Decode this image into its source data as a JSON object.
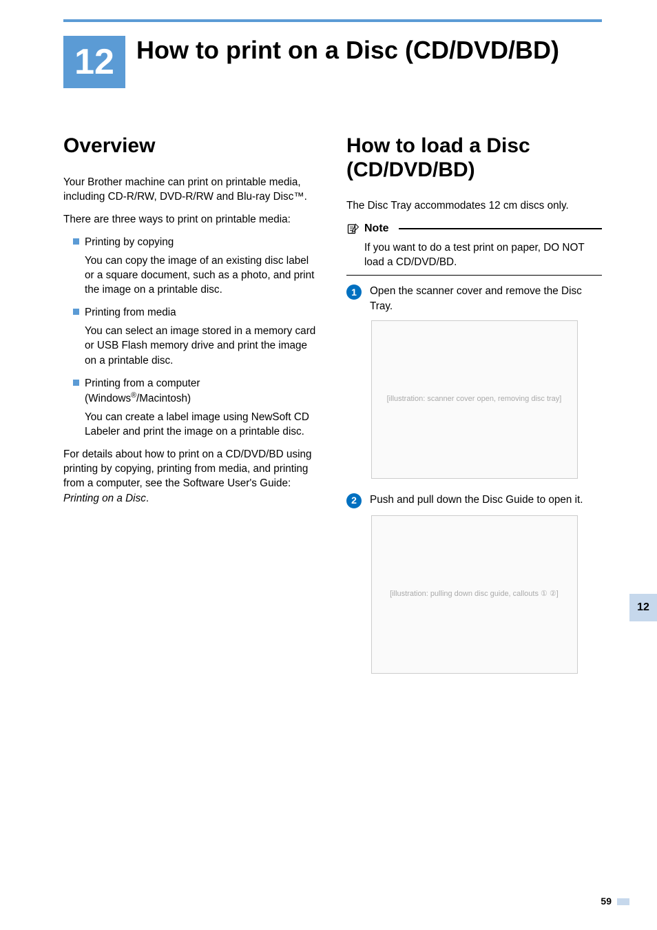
{
  "chapter": {
    "number": "12",
    "title": "How to print on a Disc (CD/DVD/BD)"
  },
  "left": {
    "heading": "Overview",
    "intro1": "Your Brother machine can print on printable media, including CD-R/RW, DVD-R/RW and Blu-ray Disc™.",
    "intro2": "There are three ways to print on printable media:",
    "bullets": [
      {
        "title": "Printing by copying",
        "desc": "You can copy the image of an existing disc label or a square document, such as a photo, and print the image on a printable disc."
      },
      {
        "title": "Printing from media",
        "desc": "You can select an image stored in a memory card or USB Flash memory drive and print the image on a printable disc."
      },
      {
        "title": "Printing from a computer (Windows®/Macintosh)",
        "title_line1": "Printing from a computer",
        "title_line2_pre": "(Windows",
        "title_line2_post": "/Macintosh)",
        "desc": "You can create a label image using NewSoft CD Labeler and print the image on a printable disc."
      }
    ],
    "footer_pre": "For details about how to print on a CD/DVD/BD using printing by copying, printing from media, and printing from a computer, see the Software User's Guide: ",
    "footer_em": "Printing on a Disc",
    "footer_post": "."
  },
  "right": {
    "heading": "How to load a Disc (CD/DVD/BD)",
    "intro": "The Disc Tray accommodates 12 cm discs only.",
    "note_label": "Note",
    "note_body": "If you want to do a test print on paper, DO NOT load a CD/DVD/BD.",
    "steps": [
      {
        "num": "1",
        "text": "Open the scanner cover and remove the Disc Tray."
      },
      {
        "num": "2",
        "text": "Push and pull down the Disc Guide to open it."
      }
    ],
    "fig1_alt": "[illustration: scanner cover open, removing disc tray]",
    "fig2_alt": "[illustration: pulling down disc guide, callouts ① ②]"
  },
  "side_tab": "12",
  "page_number": "59"
}
